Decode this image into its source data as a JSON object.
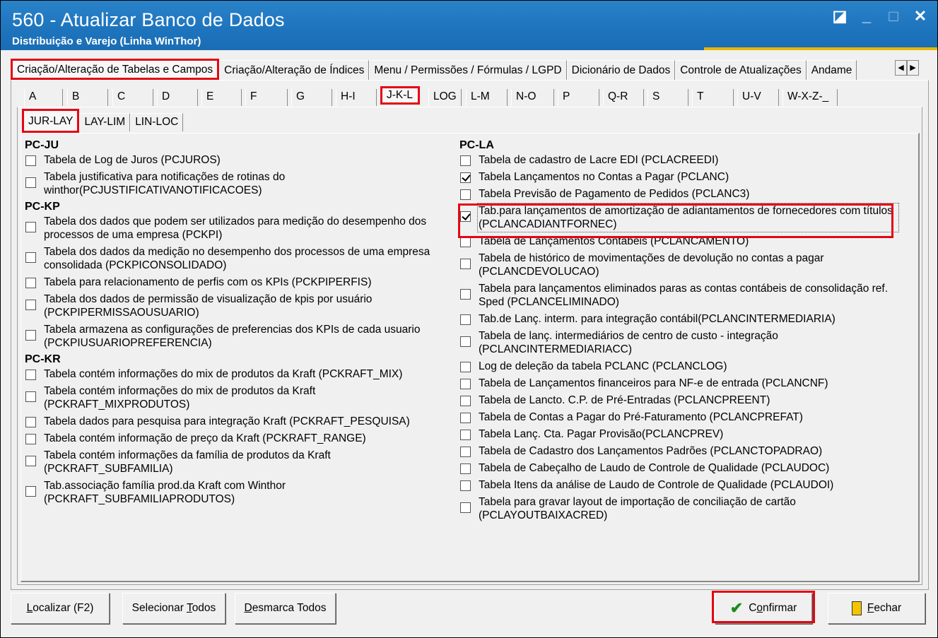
{
  "window": {
    "title": "560 - Atualizar Banco de Dados",
    "subtitle": "Distribuição e Varejo (Linha WinThor)"
  },
  "top_tabs": [
    "Criação/Alteração de Tabelas e Campos",
    "Criação/Alteração de Índices",
    "Menu / Permissões / Fórmulas / LGPD",
    "Dicionário de Dados",
    "Controle de Atualizações",
    "Andame"
  ],
  "letter_tabs": [
    "A",
    "B",
    "C",
    "D",
    "E",
    "F",
    "G",
    "H-I",
    "J-K-L",
    "LOG",
    "L-M",
    "N-O",
    "P",
    "Q-R",
    "S",
    "T",
    "U-V",
    "W-X-Z-_"
  ],
  "sub_tabs": [
    "JUR-LAY",
    "LAY-LIM",
    "LIN-LOC"
  ],
  "left_groups": [
    {
      "name": "PC-JU",
      "items": [
        {
          "text": "Tabela de Log de Juros (PCJUROS)",
          "checked": false
        },
        {
          "text": "Tabela justificativa para notificações de rotinas do winthor(PCJUSTIFICATIVANOTIFICACOES)",
          "checked": false
        }
      ]
    },
    {
      "name": "PC-KP",
      "items": [
        {
          "text": "Tabela dos dados que podem ser utilizados para medição do desempenho dos processos de uma empresa (PCKPI)",
          "checked": false
        },
        {
          "text": "Tabela dos dados da medição no desempenho dos processos de uma empresa consolidada (PCKPICONSOLIDADO)",
          "checked": false
        },
        {
          "text": "Tabela para relacionamento de perfis com os KPIs (PCKPIPERFIS)",
          "checked": false
        },
        {
          "text": "Tabela dos dados de permissão de visualização de kpis por usuário (PCKPIPERMISSAOUSUARIO)",
          "checked": false
        },
        {
          "text": "Tabela armazena as configurações de preferencias dos KPIs de cada usuario (PCKPIUSUARIOPREFERENCIA)",
          "checked": false
        }
      ]
    },
    {
      "name": "PC-KR",
      "items": [
        {
          "text": "Tabela contém informações do mix de produtos da Kraft (PCKRAFT_MIX)",
          "checked": false
        },
        {
          "text": "Tabela contém informações do mix de produtos da Kraft (PCKRAFT_MIXPRODUTOS)",
          "checked": false
        },
        {
          "text": "Tabela dados para pesquisa para integração Kraft (PCKRAFT_PESQUISA)",
          "checked": false
        },
        {
          "text": "Tabela contém informação de preço da Kraft (PCKRAFT_RANGE)",
          "checked": false
        },
        {
          "text": "Tabela contém informações da família de produtos da Kraft (PCKRAFT_SUBFAMILIA)",
          "checked": false
        },
        {
          "text": "Tab.associação família prod.da Kraft com Winthor (PCKRAFT_SUBFAMILIAPRODUTOS)",
          "checked": false
        }
      ]
    }
  ],
  "right_groups": [
    {
      "name": "PC-LA",
      "items": [
        {
          "text": "Tabela de cadastro de Lacre EDI (PCLACREEDI)",
          "checked": false
        },
        {
          "text": "Tabela Lançamentos no Contas a Pagar (PCLANC)",
          "checked": true
        },
        {
          "text": "Tabela Previsão de Pagamento de Pedidos (PCLANC3)",
          "checked": false
        },
        {
          "text": "Tab.para lançamentos de amortização de adiantamentos de fornecedores com títulos (PCLANCADIANTFORNEC)",
          "checked": true,
          "focused": true
        },
        {
          "text": "Tabela de Lançamentos Contábeis (PCLANCAMENTO)",
          "checked": false
        },
        {
          "text": "Tabela de histórico de movimentações de devolução no contas a pagar (PCLANCDEVOLUCAO)",
          "checked": false
        },
        {
          "text": "Tabela para lançamentos eliminados paras as contas contábeis de consolidação ref. Sped (PCLANCELIMINADO)",
          "checked": false
        },
        {
          "text": "Tab.de Lanç. interm. para integração contábil(PCLANCINTERMEDIARIA)",
          "checked": false
        },
        {
          "text": "Tabela de lanç.  intermediários de centro de custo - integração (PCLANCINTERMEDIARIACC)",
          "checked": false
        },
        {
          "text": "Log de deleção da tabela PCLANC (PCLANCLOG)",
          "checked": false
        },
        {
          "text": "Tabela de Lançamentos financeiros para NF-e de entrada (PCLANCNF)",
          "checked": false
        },
        {
          "text": "Tabela de Lancto. C.P. de Pré-Entradas (PCLANCPREENT)",
          "checked": false
        },
        {
          "text": "Tabela de Contas a Pagar do Pré-Faturamento (PCLANCPREFAT)",
          "checked": false
        },
        {
          "text": "Tabela Lanç. Cta. Pagar Provisão(PCLANCPREV)",
          "checked": false
        },
        {
          "text": "Tabela de Cadastro dos Lançamentos Padrões (PCLANCTOPADRAO)",
          "checked": false
        },
        {
          "text": "Tabela de Cabeçalho de Laudo de Controle de Qualidade (PCLAUDOC)",
          "checked": false
        },
        {
          "text": "Tabela Itens da análise de Laudo de Controle de Qualidade (PCLAUDOI)",
          "checked": false
        },
        {
          "text": "Tabela para gravar layout de importação de conciliação de cartão (PCLAYOUTBAIXACRED)",
          "checked": false
        }
      ]
    }
  ],
  "buttons": {
    "localizar": {
      "pre": "",
      "u": "L",
      "post": "ocalizar (F2)"
    },
    "selecionar": {
      "pre": "Selecionar ",
      "u": "T",
      "post": "odos"
    },
    "desmarca": {
      "pre": "",
      "u": "D",
      "post": "esmarca Todos"
    },
    "confirmar": {
      "pre": "C",
      "u": "o",
      "post": "nfirmar"
    },
    "fechar": {
      "pre": "",
      "u": "F",
      "post": "echar"
    }
  }
}
